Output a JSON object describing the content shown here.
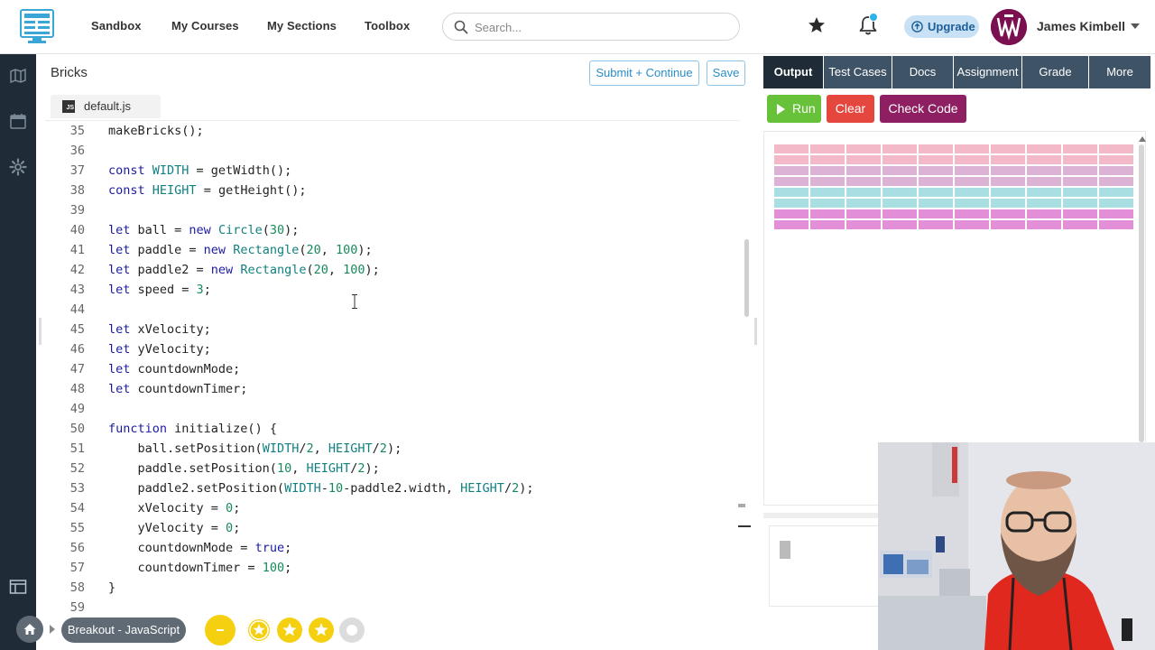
{
  "nav": {
    "links": [
      "Sandbox",
      "My Courses",
      "My Sections",
      "Toolbox"
    ],
    "search_placeholder": "Search...",
    "upgrade_label": "Upgrade",
    "user_name": "James Kimbell",
    "notification_dot": true
  },
  "sidebar": {
    "icons": [
      "map-icon",
      "calendar-icon",
      "gear-icon",
      "layout-icon"
    ]
  },
  "editor": {
    "title": "Bricks",
    "submit_label": "Submit + Continue",
    "save_label": "Save",
    "file_tab": "default.js",
    "file_badge": "JS",
    "lines": [
      {
        "num": "35",
        "code": [
          [
            "makeBricks();",
            ""
          ]
        ]
      },
      {
        "num": "36",
        "code": []
      },
      {
        "num": "37",
        "code": [
          [
            "const",
            "k"
          ],
          [
            " ",
            ""
          ],
          [
            "WIDTH",
            "c"
          ],
          [
            " = getWidth();",
            ""
          ]
        ]
      },
      {
        "num": "38",
        "code": [
          [
            "const",
            "k"
          ],
          [
            " ",
            ""
          ],
          [
            "HEIGHT",
            "c"
          ],
          [
            " = getHeight();",
            ""
          ]
        ]
      },
      {
        "num": "39",
        "code": []
      },
      {
        "num": "40",
        "code": [
          [
            "let",
            "k"
          ],
          [
            " ball = ",
            ""
          ],
          [
            "new",
            "k"
          ],
          [
            " ",
            ""
          ],
          [
            "Circle",
            "c"
          ],
          [
            "(",
            ""
          ],
          [
            "30",
            "n"
          ],
          [
            ");",
            ""
          ]
        ]
      },
      {
        "num": "41",
        "code": [
          [
            "let",
            "k"
          ],
          [
            " paddle = ",
            ""
          ],
          [
            "new",
            "k"
          ],
          [
            " ",
            ""
          ],
          [
            "Rectangle",
            "c"
          ],
          [
            "(",
            ""
          ],
          [
            "20",
            "n"
          ],
          [
            ", ",
            ""
          ],
          [
            "100",
            "n"
          ],
          [
            ");",
            ""
          ]
        ]
      },
      {
        "num": "42",
        "code": [
          [
            "let",
            "k"
          ],
          [
            " paddle2 = ",
            ""
          ],
          [
            "new",
            "k"
          ],
          [
            " ",
            ""
          ],
          [
            "Rectangle",
            "c"
          ],
          [
            "(",
            ""
          ],
          [
            "20",
            "n"
          ],
          [
            ", ",
            ""
          ],
          [
            "100",
            "n"
          ],
          [
            ");",
            ""
          ]
        ]
      },
      {
        "num": "43",
        "code": [
          [
            "let",
            "k"
          ],
          [
            " speed = ",
            ""
          ],
          [
            "3",
            "n"
          ],
          [
            ";",
            ""
          ]
        ]
      },
      {
        "num": "44",
        "code": []
      },
      {
        "num": "45",
        "code": [
          [
            "let",
            "k"
          ],
          [
            " xVelocity;",
            ""
          ]
        ]
      },
      {
        "num": "46",
        "code": [
          [
            "let",
            "k"
          ],
          [
            " yVelocity;",
            ""
          ]
        ]
      },
      {
        "num": "47",
        "code": [
          [
            "let",
            "k"
          ],
          [
            " countdownMode;",
            ""
          ]
        ]
      },
      {
        "num": "48",
        "code": [
          [
            "let",
            "k"
          ],
          [
            " countdownTimer;",
            ""
          ]
        ]
      },
      {
        "num": "49",
        "code": []
      },
      {
        "num": "50",
        "code": [
          [
            "function",
            "k"
          ],
          [
            " initialize() {",
            ""
          ]
        ]
      },
      {
        "num": "51",
        "code": [
          [
            "    ball.setPosition(",
            ""
          ],
          [
            "WIDTH",
            "c"
          ],
          [
            "/",
            ""
          ],
          [
            "2",
            "n"
          ],
          [
            ", ",
            ""
          ],
          [
            "HEIGHT",
            "c"
          ],
          [
            "/",
            ""
          ],
          [
            "2",
            "n"
          ],
          [
            ");",
            ""
          ]
        ]
      },
      {
        "num": "52",
        "code": [
          [
            "    paddle.setPosition(",
            ""
          ],
          [
            "10",
            "n"
          ],
          [
            ", ",
            ""
          ],
          [
            "HEIGHT",
            "c"
          ],
          [
            "/",
            ""
          ],
          [
            "2",
            "n"
          ],
          [
            ");",
            ""
          ]
        ]
      },
      {
        "num": "53",
        "code": [
          [
            "    paddle2.setPosition(",
            ""
          ],
          [
            "WIDTH",
            "c"
          ],
          [
            "-",
            ""
          ],
          [
            "10",
            "n"
          ],
          [
            "-paddle2.width, ",
            ""
          ],
          [
            "HEIGHT",
            "c"
          ],
          [
            "/",
            ""
          ],
          [
            "2",
            "n"
          ],
          [
            ");",
            ""
          ]
        ]
      },
      {
        "num": "54",
        "code": [
          [
            "    xVelocity = ",
            ""
          ],
          [
            "0",
            "n"
          ],
          [
            ";",
            ""
          ]
        ]
      },
      {
        "num": "55",
        "code": [
          [
            "    yVelocity = ",
            ""
          ],
          [
            "0",
            "n"
          ],
          [
            ";",
            ""
          ]
        ]
      },
      {
        "num": "56",
        "code": [
          [
            "    countdownMode = ",
            ""
          ],
          [
            "true",
            "k"
          ],
          [
            ";",
            ""
          ]
        ]
      },
      {
        "num": "57",
        "code": [
          [
            "    countdownTimer = ",
            ""
          ],
          [
            "100",
            "n"
          ],
          [
            ";",
            ""
          ]
        ]
      },
      {
        "num": "58",
        "code": [
          [
            "}",
            ""
          ]
        ]
      },
      {
        "num": "59",
        "code": []
      }
    ]
  },
  "output": {
    "tabs": [
      "Output",
      "Test Cases",
      "Docs",
      "Assignment",
      "Grade",
      "More"
    ],
    "active_tab": "Output",
    "run_label": "Run",
    "clear_label": "Clear",
    "check_label": "Check Code",
    "brick_rows": 8,
    "brick_cols": 10,
    "brick_colors": [
      "#f3b9c8",
      "#f3b9c8",
      "#dcb3d4",
      "#dcb3d4",
      "#a9dfe3",
      "#a9dfe3",
      "#e38fd8",
      "#e38fd8"
    ]
  },
  "footer": {
    "breadcrumb": "Breakout - JavaScript",
    "levels": [
      "minus-icon",
      "star-icon",
      "star-icon",
      "star-icon",
      "circle-icon"
    ]
  },
  "colors": {
    "navy": "#1f2b37",
    "tab": "#3f5367",
    "run": "#67c23a",
    "clear": "#e5473f",
    "check": "#8e1f62",
    "accent_blue": "#2b8ec9",
    "gold": "#f5d010"
  }
}
